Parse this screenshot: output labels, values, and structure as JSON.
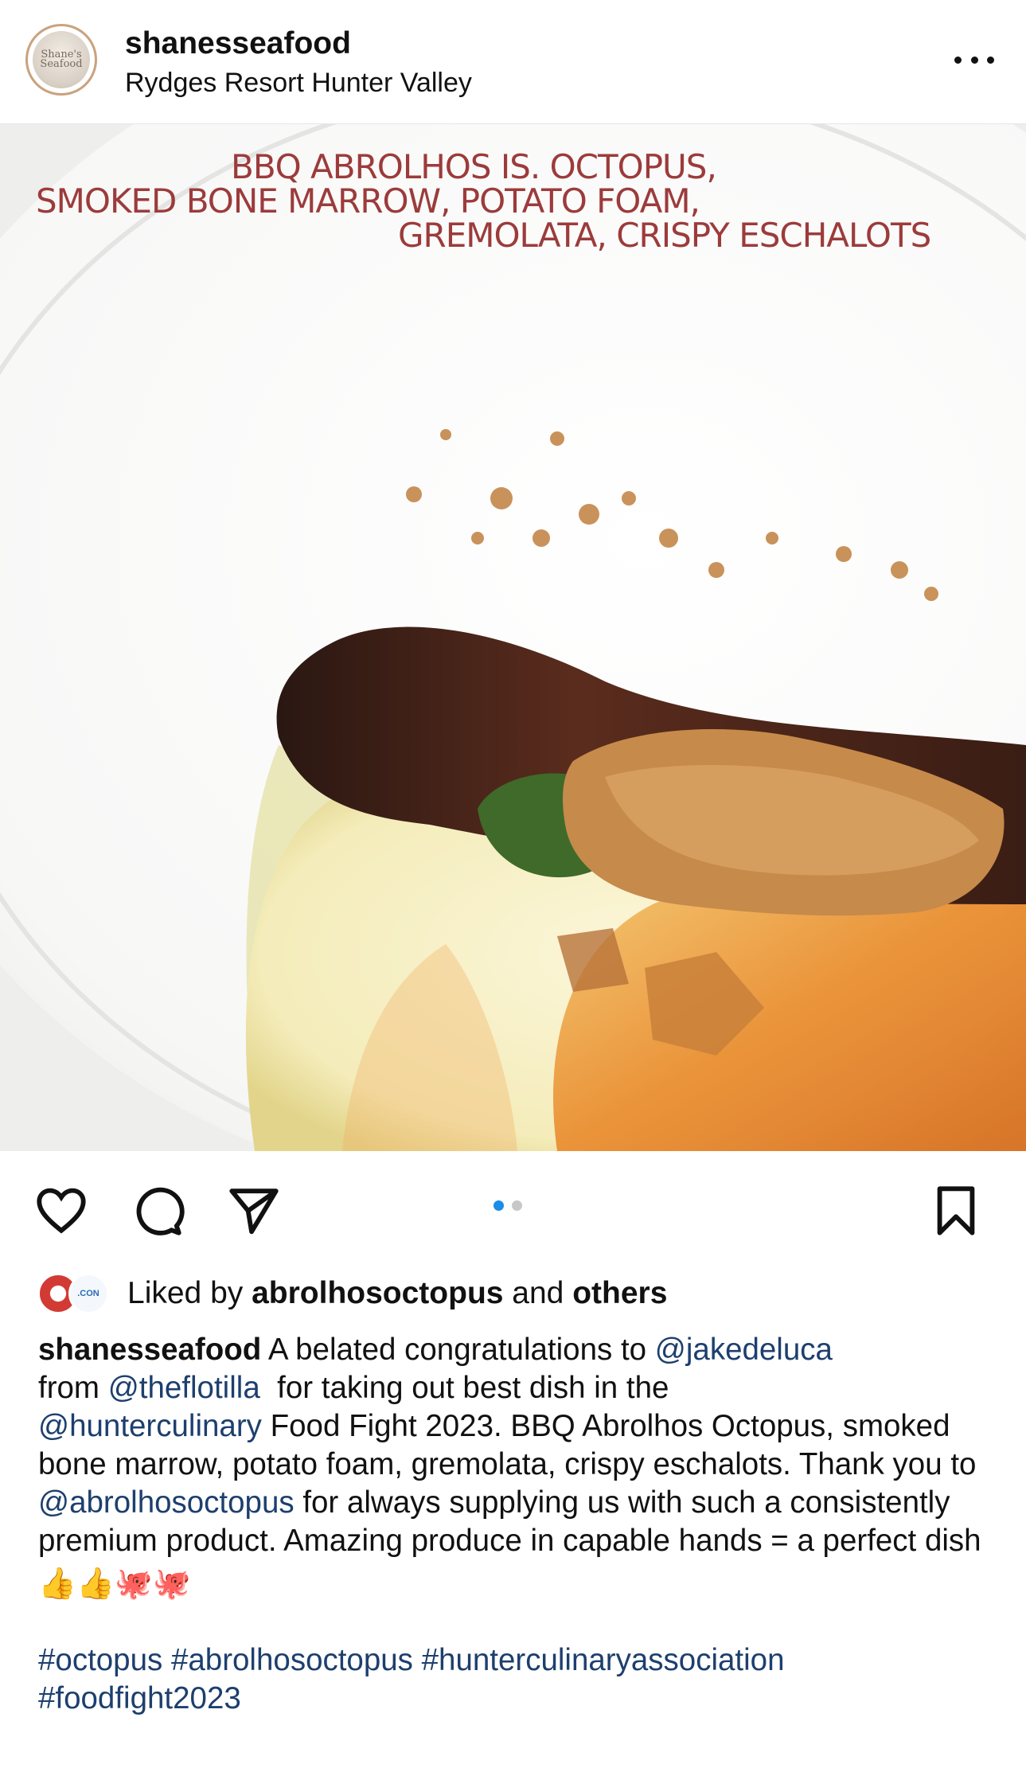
{
  "post": {
    "username": "shanesseafood",
    "location": "Rydges Resort Hunter Valley",
    "avatar_text": "Shane's Seafood",
    "image_text": [
      "BBQ ABROLHOS IS. OCTOPUS,",
      "SMOKED BONE MARROW, POTATO FOAM,",
      "GREMOLATA, CRISPY ESCHALOTS"
    ],
    "carousel": {
      "count": 2,
      "active": 0
    }
  },
  "likes": {
    "prefix": "Liked by",
    "user": "abrolhosoctopus",
    "joiner": "and",
    "others": "others",
    "avatar2_text": ".CON"
  },
  "caption": {
    "username": "shanesseafood",
    "t1": "A belated congratulations to",
    "m1": "@jakedeluca",
    "t2": "from",
    "m2": "@theflotilla",
    "t3": "for taking out best dish in the",
    "m3": "@hunterculinary",
    "t4": "Food Fight 2023. BBQ Abrolhos Octopus, smoked bone marrow, potato foam, gremolata, crispy eschalots. Thank you to",
    "m4": "@abrolhosoctopus",
    "t5": "for always supplying us with such a consistently premium product. Amazing produce in capable hands = a perfect dish",
    "emoji_thumbs_1": "👍",
    "emoji_thumbs_2": "👍",
    "emoji_octopus_1": "🐙",
    "emoji_octopus_2": "🐙",
    "tag1": "#octopus",
    "tag2": "#abrolhosoctopus",
    "tag3": "#hunterculinaryassociation",
    "tag4": "#foodfight2023"
  },
  "colors": {
    "mention": "#1d3f6e",
    "carousel_active": "#1a8de6",
    "image_text": "#9c3b3b"
  },
  "icons": [
    "heart-icon",
    "comment-icon",
    "share-icon",
    "bookmark-icon",
    "more-icon"
  ]
}
